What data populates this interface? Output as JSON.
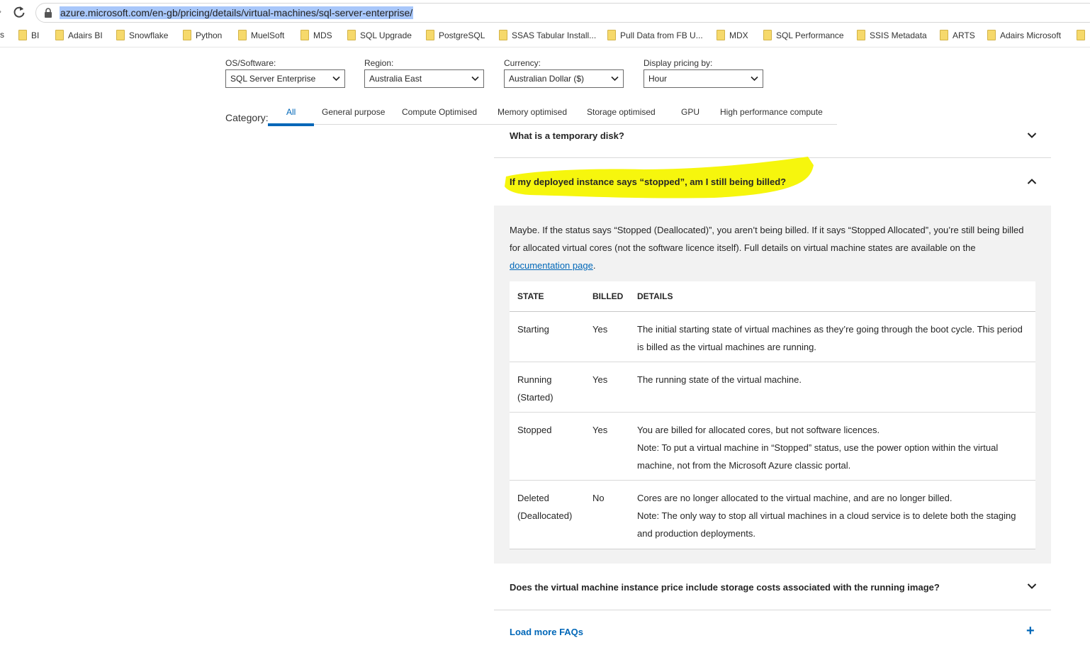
{
  "browser": {
    "back_glyph": "›",
    "url": "azure.microsoft.com/en-gb/pricing/details/virtual-machines/sql-server-enterprise/",
    "bookmark_cut_label": "s",
    "bookmarks": [
      "BI",
      "Adairs BI",
      "Snowflake",
      "Python",
      "MuelSoft",
      "MDS",
      "SQL Upgrade",
      "PostgreSQL",
      "SSAS Tabular Install...",
      "Pull Data from FB U...",
      "MDX",
      "SQL Performance",
      "SSIS Metadata",
      "ARTS",
      "Adairs Microsoft",
      ""
    ]
  },
  "filters": {
    "os": {
      "label": "OS/Software:",
      "value": "SQL Server Enterprise"
    },
    "region": {
      "label": "Region:",
      "value": "Australia East"
    },
    "currency": {
      "label": "Currency:",
      "value": "Australian Dollar ($)"
    },
    "display": {
      "label": "Display pricing by:",
      "value": "Hour"
    }
  },
  "category": {
    "label": "Category:",
    "tabs": [
      "All",
      "General purpose",
      "Compute Optimised",
      "Memory optimised",
      "Storage optimised",
      "GPU",
      "High performance compute"
    ],
    "active": "All"
  },
  "faq": {
    "q1": "What is a temporary disk?",
    "q2": "If my deployed instance says “stopped”, am I still being billed?",
    "answer_intro": "Maybe. If the status says “Stopped (Deallocated)”, you aren’t being billed. If it says “Stopped Allocated”, you’re still being billed for allocated virtual cores (not the software licence itself). Full details on virtual machine states are available on the ",
    "answer_link": "documentation page",
    "answer_end": ".",
    "table": {
      "headers": [
        "STATE",
        "BILLED",
        "DETAILS"
      ],
      "rows": [
        {
          "state": "Starting",
          "billed": "Yes",
          "details": "The initial starting state of virtual machines as they’re going through the boot cycle. This period is billed as the virtual machines are running."
        },
        {
          "state": "Running (Started)",
          "billed": "Yes",
          "details": "The running state of the virtual machine."
        },
        {
          "state": "Stopped",
          "billed": "Yes",
          "details": "You are billed for allocated cores, but not software licences.",
          "note": "Note: To put a virtual machine in “Stopped” status, use the power option within the virtual machine, not from the Microsoft Azure classic portal."
        },
        {
          "state": "Deleted (Deallocated)",
          "billed": "No",
          "details": "Cores are no longer allocated to the virtual machine, and are no longer billed.",
          "note": "Note: The only way to stop all virtual machines in a cloud service is to delete both the staging and production deployments."
        }
      ]
    },
    "q3": "Does the virtual machine instance price include storage costs associated with the running image?",
    "load_more": "Load more FAQs",
    "load_more_glyph": "+"
  },
  "colors": {
    "accent": "#0067b8",
    "highlight": "#f5f500",
    "answer_bg": "#f2f2f2"
  },
  "icons": [
    "lock-icon",
    "reload-icon",
    "folder-icon",
    "chevron-down-icon",
    "chevron-up-icon",
    "plus-icon"
  ]
}
